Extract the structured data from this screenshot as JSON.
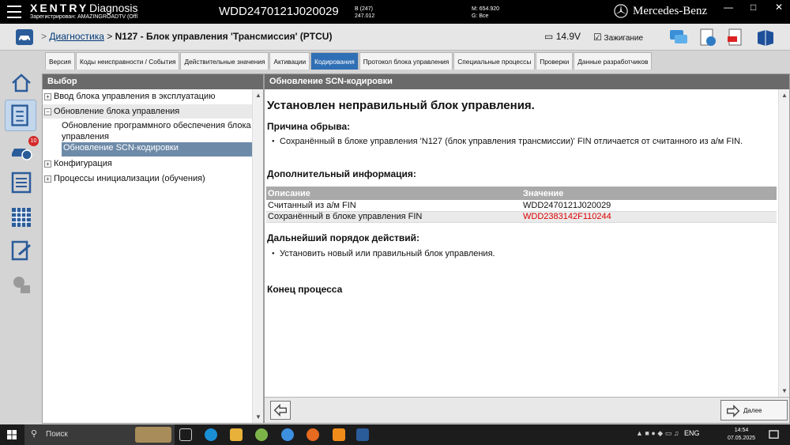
{
  "titlebar": {
    "brand": "XENTRY",
    "brand_sub": "Diagnosis",
    "registered": "Зарегистрирован: AMAZINGROADTV (Offl",
    "vin": "WDD2470121J020029",
    "vehicle_line1": "B (247)",
    "vehicle_line2": "247.012",
    "model_line1": "M: 654.920",
    "model_line2": "G: Все",
    "oem": "Mercedes-Benz",
    "minimize": "—",
    "maximize": "□",
    "close": "✕"
  },
  "header": {
    "breadcrumb_link": "Диагностика",
    "breadcrumb_sep": " > ",
    "breadcrumb_current": "N127 - Блок управления 'Трансмиссия' (PTCU)",
    "breadcrumb_prefix": ">",
    "battery": "14.9V",
    "ignition": "Зажигание"
  },
  "tabs": [
    {
      "label": "Версия"
    },
    {
      "label": "Коды неисправности / События"
    },
    {
      "label": "Действительные значения"
    },
    {
      "label": "Активации"
    },
    {
      "label": "Кодирования"
    },
    {
      "label": "Протокол блока управления"
    },
    {
      "label": "Специальные процессы"
    },
    {
      "label": "Проверки"
    },
    {
      "label": "Данные разработчиков"
    }
  ],
  "active_tab_index": 4,
  "sidebar": {
    "badge_count": "10"
  },
  "left_panel": {
    "title": "Выбор",
    "items": [
      {
        "label": "Ввод блока управления в эксплуатацию",
        "expander": "+"
      },
      {
        "label": "Обновление блока управления",
        "expander": "−"
      },
      {
        "label": "Обновление программного обеспечения блока управления"
      },
      {
        "label": "Обновление SCN-кодировки"
      },
      {
        "label": "Конфигурация",
        "expander": "+"
      },
      {
        "label": "Процессы инициализации (обучения)",
        "expander": "+"
      }
    ]
  },
  "right_panel": {
    "title": "Обновление SCN-кодировки",
    "heading": "Установлен неправильный блок управления.",
    "cause_heading": "Причина обрыва:",
    "cause_text": "Сохранённый в блоке управления 'N127 (блок управления трансмиссии)' FIN отличается от считанного из а/м FIN.",
    "additional_heading": "Дополнительный информация:",
    "table": {
      "headers": [
        "Описание",
        "Значение"
      ],
      "rows": [
        {
          "label": "Считанный из а/м FIN",
          "value": "WDD2470121J020029"
        },
        {
          "label": "Сохранённый в блоке управления FIN",
          "value": "WDD2383142F110244"
        }
      ]
    },
    "next_heading": "Дальнейший порядок действий:",
    "next_text": "Установить новый или правильный блок управления.",
    "end_text": "Конец процесса",
    "next_button": "Далее"
  },
  "taskbar": {
    "search": "Поиск",
    "lang": "ENG",
    "time": "14:54",
    "date": "07.05.2025"
  },
  "colors": {
    "accent": "#2f6fb5",
    "panel_header": "#6a6a6a",
    "selected": "#6d8aa8",
    "error_text": "#dd0000"
  }
}
